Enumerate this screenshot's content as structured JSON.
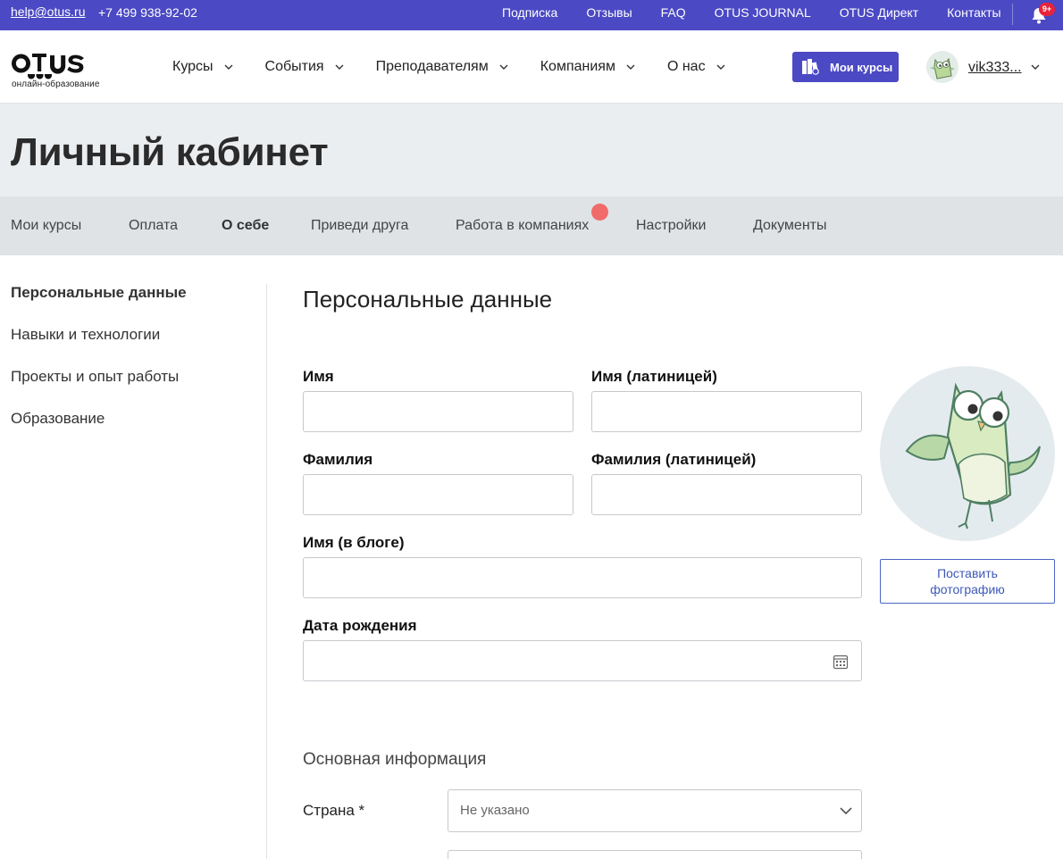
{
  "topbar": {
    "email": "help@otus.ru",
    "phone": "+7 499 938-92-02",
    "links": [
      "Подписка",
      "Отзывы",
      "FAQ",
      "OTUS JOURNAL",
      "OTUS Директ",
      "Контакты"
    ],
    "notifications_badge": "9+"
  },
  "header": {
    "logo_subtitle": "онлайн-образование",
    "nav": [
      "Курсы",
      "События",
      "Преподавателям",
      "Компаниям",
      "О нас"
    ],
    "my_courses_label": "Мои курсы",
    "username": "vik333..."
  },
  "page": {
    "title": "Личный кабинет"
  },
  "tabs": [
    "Мои курсы",
    "Оплата",
    "О себе",
    "Приведи друга",
    "Работа в компаниях",
    "Настройки",
    "Документы"
  ],
  "active_tab": "О себе",
  "sidebar": {
    "items": [
      "Персональные данные",
      "Навыки и технологии",
      "Проекты и опыт работы",
      "Образование"
    ],
    "active": "Персональные данные"
  },
  "form": {
    "title": "Персональные данные",
    "first_name_label": "Имя",
    "first_name_latin_label": "Имя (латиницей)",
    "last_name_label": "Фамилия",
    "last_name_latin_label": "Фамилия (латиницей)",
    "blog_name_label": "Имя (в блоге)",
    "birth_date_label": "Дата рождения",
    "photo_button": "Поставить фотографию",
    "basic_info_title": "Основная информация",
    "country_label": "Страна *",
    "country_value": "Не указано"
  },
  "colors": {
    "brand": "#4b49c4",
    "notification": "#e8233c",
    "tab_dot": "#f16b6b"
  }
}
